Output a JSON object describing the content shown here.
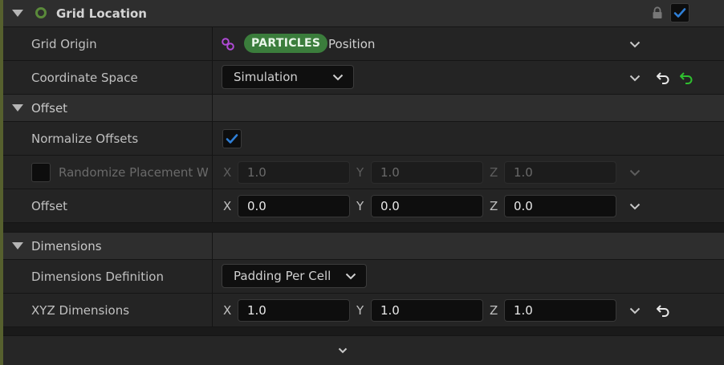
{
  "section": {
    "title": "Grid Location",
    "enabled": true
  },
  "grid_origin": {
    "label": "Grid Origin",
    "namespace_badge": "PARTICLES",
    "value": "Position"
  },
  "coordinate_space": {
    "label": "Coordinate Space",
    "value": "Simulation"
  },
  "offset_group": {
    "title": "Offset",
    "normalize_label": "Normalize Offsets",
    "normalize_checked": true,
    "randomize_label": "Randomize Placement Wi",
    "randomize_checked": false,
    "randomize_x": "1.0",
    "randomize_y": "1.0",
    "randomize_z": "1.0",
    "offset_label": "Offset",
    "offset_x": "0.0",
    "offset_y": "0.0",
    "offset_z": "0.0"
  },
  "dimensions_group": {
    "title": "Dimensions",
    "definition_label": "Dimensions Definition",
    "definition_value": "Padding Per Cell",
    "xyz_label": "XYZ Dimensions",
    "xyz_x": "1.0",
    "xyz_y": "1.0",
    "xyz_z": "1.0"
  },
  "axes": {
    "x": "X",
    "y": "Y",
    "z": "Z"
  },
  "colors": {
    "check_blue": "#2f7fd6",
    "reset_green": "#2fbf2f",
    "badge_green": "#3b7d3c",
    "link_purple": "#b04ad6"
  }
}
